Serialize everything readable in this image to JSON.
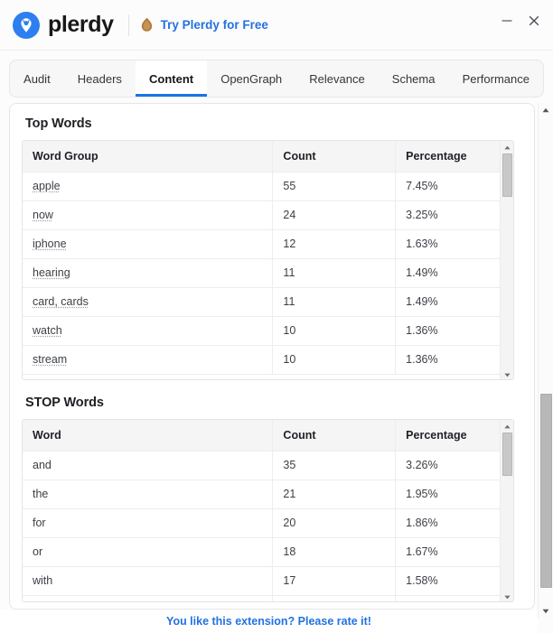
{
  "window": {
    "brand_name": "plerdy",
    "logo_icon": "plerdy-pin-logo-icon",
    "promo_icon": "flame-icon",
    "promo_label": "Try Plerdy for Free",
    "minimize_icon": "minimize-icon",
    "close_icon": "close-icon",
    "accent_color": "#2372e0",
    "logo_color": "#2d7ff0"
  },
  "tabs": {
    "active": "Content",
    "items": [
      {
        "label": "Audit"
      },
      {
        "label": "Headers"
      },
      {
        "label": "Content"
      },
      {
        "label": "OpenGraph"
      },
      {
        "label": "Relevance"
      },
      {
        "label": "Schema"
      },
      {
        "label": "Performance"
      }
    ]
  },
  "sections": {
    "top_words": {
      "title": "Top Words",
      "columns": [
        "Word Group",
        "Count",
        "Percentage"
      ],
      "rows": [
        {
          "word": "apple",
          "count": "55",
          "percentage": "7.45%",
          "flagged": true
        },
        {
          "word": "now",
          "count": "24",
          "percentage": "3.25%",
          "flagged": true
        },
        {
          "word": "iphone",
          "count": "12",
          "percentage": "1.63%",
          "flagged": true
        },
        {
          "word": "hearing",
          "count": "11",
          "percentage": "1.49%",
          "flagged": true
        },
        {
          "word": "card, cards",
          "count": "11",
          "percentage": "1.49%",
          "flagged": true
        },
        {
          "word": "watch",
          "count": "10",
          "percentage": "1.36%",
          "flagged": true
        },
        {
          "word": "stream",
          "count": "10",
          "percentage": "1.36%",
          "flagged": true
        }
      ]
    },
    "stop_words": {
      "title": "STOP Words",
      "columns": [
        "Word",
        "Count",
        "Percentage"
      ],
      "rows": [
        {
          "word": "and",
          "count": "35",
          "percentage": "3.26%",
          "flagged": false
        },
        {
          "word": "the",
          "count": "21",
          "percentage": "1.95%",
          "flagged": false
        },
        {
          "word": "for",
          "count": "20",
          "percentage": "1.86%",
          "flagged": false
        },
        {
          "word": "or",
          "count": "18",
          "percentage": "1.67%",
          "flagged": false
        },
        {
          "word": "with",
          "count": "17",
          "percentage": "1.58%",
          "flagged": false
        }
      ]
    }
  },
  "scrollbars": {
    "top_words": {
      "up_icon": "scroll-up-arrow-icon",
      "down_icon": "scroll-down-arrow-icon"
    },
    "stop_words": {
      "up_icon": "scroll-up-arrow-icon",
      "down_icon": "scroll-down-arrow-icon"
    },
    "page": {
      "up_icon": "scroll-up-arrow-icon",
      "down_icon": "scroll-down-arrow-icon"
    }
  },
  "footer": {
    "rate_label": "You like this extension? Please rate it!"
  }
}
